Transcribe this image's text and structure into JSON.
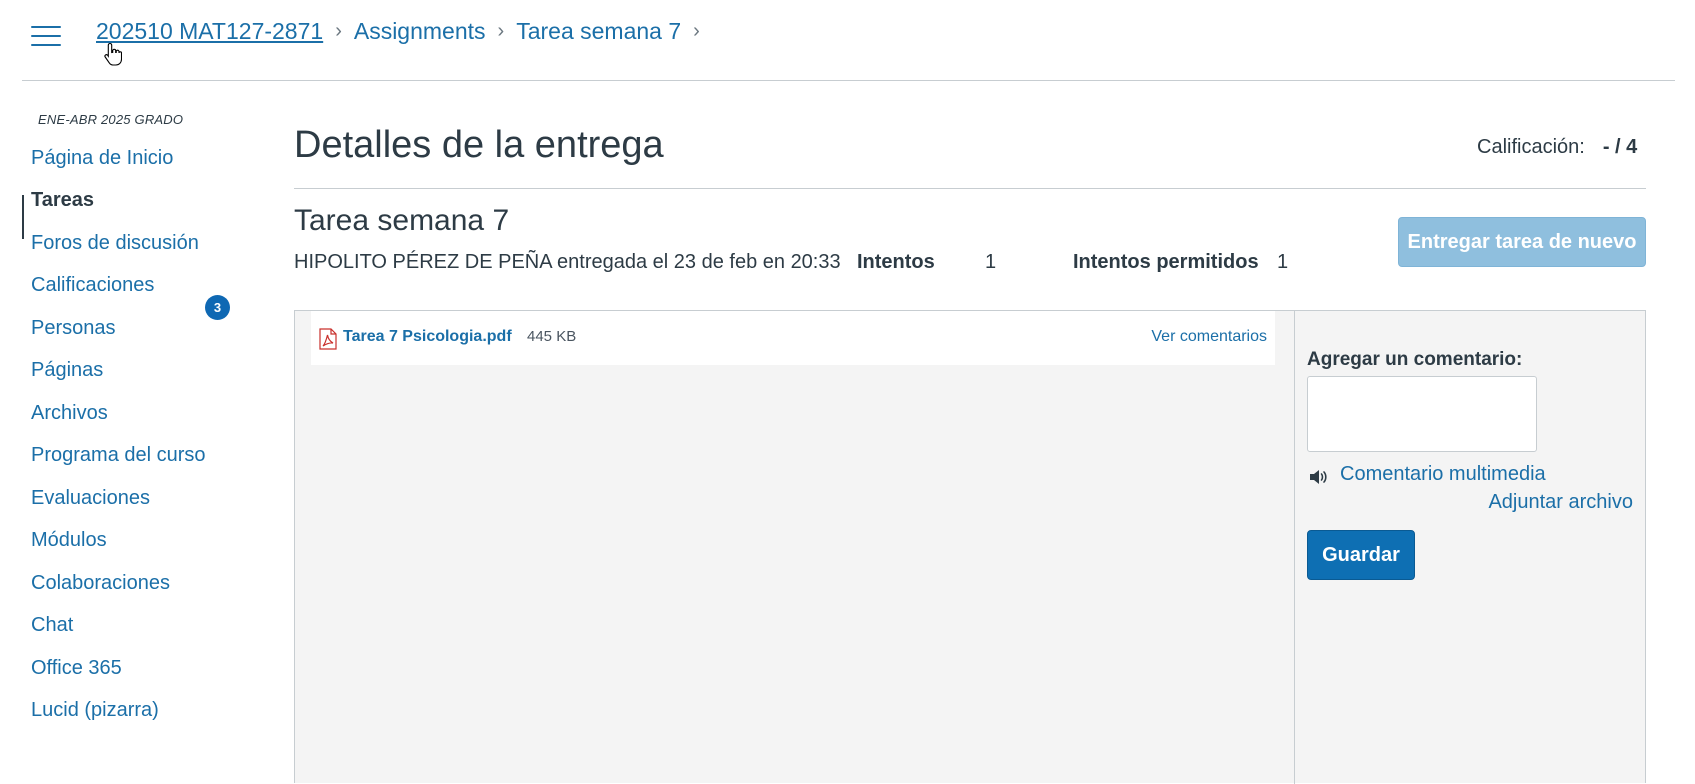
{
  "header": {
    "breadcrumb": [
      "202510 MAT127-2871",
      "Assignments",
      "Tarea semana 7"
    ]
  },
  "sidebar": {
    "term": "ENE-ABR 2025 GRADO",
    "items": [
      {
        "label": "Página de Inicio"
      },
      {
        "label": "Tareas",
        "active": true
      },
      {
        "label": "Foros de discusión"
      },
      {
        "label": "Calificaciones",
        "badge": "3"
      },
      {
        "label": "Personas"
      },
      {
        "label": "Páginas"
      },
      {
        "label": "Archivos"
      },
      {
        "label": "Programa del curso"
      },
      {
        "label": "Evaluaciones"
      },
      {
        "label": "Módulos"
      },
      {
        "label": "Colaboraciones"
      },
      {
        "label": "Chat"
      },
      {
        "label": "Office 365"
      },
      {
        "label": "Lucid (pizarra)"
      }
    ]
  },
  "main": {
    "title": "Detalles de la entrega",
    "grade_label": "Calificación:",
    "grade_value": "- / 4",
    "assignment_title": "Tarea semana 7",
    "submitted_by": "HIPOLITO PÉREZ DE PEÑA entregada el 23 de feb en 20:33",
    "attempts_label": "Intentos",
    "attempts_value": "1",
    "allowed_label": "Intentos permitidos",
    "allowed_value": "1",
    "resubmit_label": "Entregar tarea de nuevo"
  },
  "file": {
    "name": "Tarea 7 Psicologia.pdf",
    "size": "445 KB",
    "view_comments": "Ver comentarios"
  },
  "comments": {
    "label": "Agregar un comentario:",
    "media_link": "Comentario multimedia",
    "attach_link": "Adjuntar archivo",
    "save_label": "Guardar"
  },
  "colors": {
    "link": "#1b6fa8",
    "primary_button": "#0e6fb3",
    "disabled_button": "#8fbfde",
    "badge": "#0e68b3"
  }
}
